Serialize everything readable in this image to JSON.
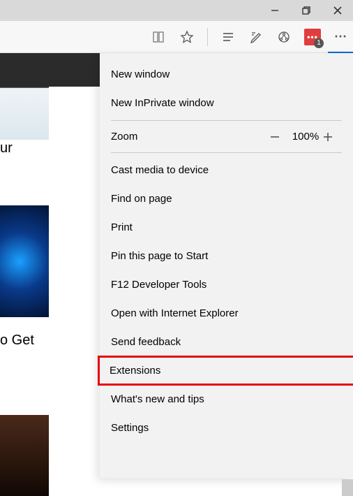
{
  "window": {
    "minimize": "minimize",
    "restore": "restore",
    "close": "close"
  },
  "toolbar": {
    "reading_list": "reading-list",
    "favorite": "favorite",
    "hub": "hub",
    "notes": "notes",
    "share": "share",
    "extension_badge_count": "1",
    "more": "⋯"
  },
  "page": {
    "headline1": "ur",
    "headline2": "o Get"
  },
  "menu": {
    "new_window": "New window",
    "new_inprivate": "New InPrivate window",
    "zoom_label": "Zoom",
    "zoom_value": "100%",
    "cast": "Cast media to device",
    "find": "Find on page",
    "print": "Print",
    "pin": "Pin this page to Start",
    "devtools": "F12 Developer Tools",
    "open_ie": "Open with Internet Explorer",
    "feedback": "Send feedback",
    "extensions": "Extensions",
    "whats_new": "What's new and tips",
    "settings": "Settings"
  }
}
